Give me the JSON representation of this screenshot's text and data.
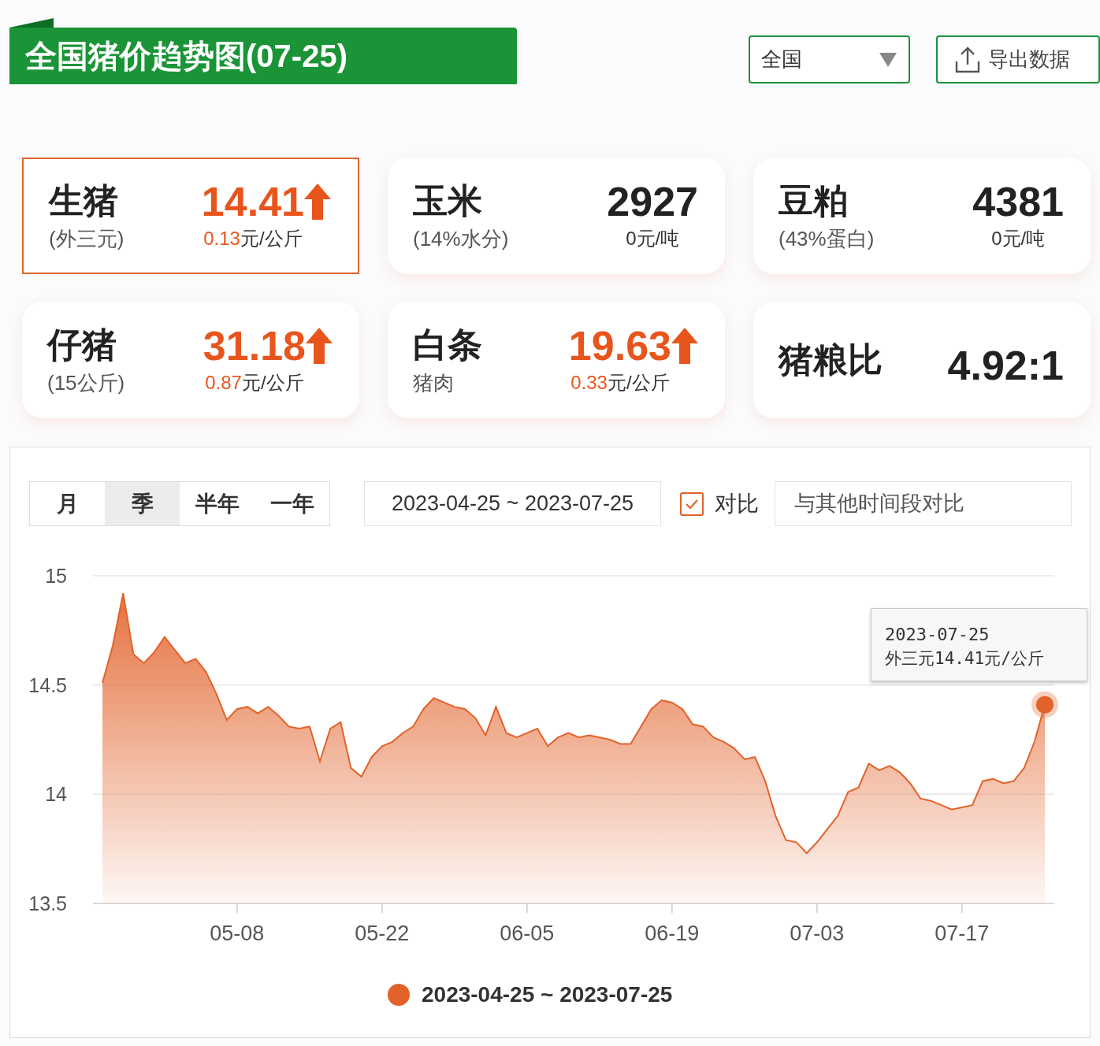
{
  "header": {
    "title": "全国猪价趋势图(07-25)",
    "region_select": {
      "value": "全国"
    },
    "export_button": "导出数据"
  },
  "cards": [
    {
      "kind": "price",
      "name": "生猪",
      "sub": "(外三元)",
      "value": "14.41",
      "rising": true,
      "change": "0.13",
      "unit": "元/公斤",
      "selected": true
    },
    {
      "kind": "price",
      "name": "玉米",
      "sub": "(14%水分)",
      "value": "2927",
      "rising": false,
      "change": "0",
      "unit": "元/吨",
      "selected": false
    },
    {
      "kind": "price",
      "name": "豆粕",
      "sub": "(43%蛋白)",
      "value": "4381",
      "rising": false,
      "change": "0",
      "unit": "元/吨",
      "selected": false
    },
    {
      "kind": "price",
      "name": "仔猪",
      "sub": "(15公斤)",
      "value": "31.18",
      "rising": true,
      "change": "0.87",
      "unit": "元/公斤",
      "selected": false
    },
    {
      "kind": "price",
      "name": "白条",
      "sub": "猪肉",
      "value": "19.63",
      "rising": true,
      "change": "0.33",
      "unit": "元/公斤",
      "selected": false
    },
    {
      "kind": "ratio",
      "name": "猪粮比",
      "value": "4.92:1",
      "selected": false
    }
  ],
  "controls": {
    "periods": [
      {
        "label": "月",
        "selected": false
      },
      {
        "label": "季",
        "selected": true
      },
      {
        "label": "半年",
        "selected": false
      },
      {
        "label": "一年",
        "selected": false
      }
    ],
    "date_range": "2023-04-25 ~ 2023-07-25",
    "compare": {
      "label": "对比",
      "checked": true
    },
    "compare_field": {
      "placeholder": "与其他时间段对比"
    }
  },
  "chart": {
    "tooltip": {
      "date": "2023-07-25",
      "text": "外三元14.41元/公斤"
    },
    "chart_data": {
      "type": "area",
      "categories": [
        null,
        null,
        null,
        null,
        null,
        null,
        null,
        null,
        null,
        null,
        null,
        null,
        null,
        "05-08",
        null,
        null,
        null,
        null,
        null,
        null,
        null,
        null,
        null,
        null,
        null,
        null,
        null,
        "05-22",
        null,
        null,
        null,
        null,
        null,
        null,
        null,
        null,
        null,
        null,
        null,
        null,
        null,
        "06-05",
        null,
        null,
        null,
        null,
        null,
        null,
        null,
        null,
        null,
        null,
        null,
        null,
        null,
        "06-19",
        null,
        null,
        null,
        null,
        null,
        null,
        null,
        null,
        null,
        null,
        null,
        null,
        null,
        "07-03",
        null,
        null,
        null,
        null,
        null,
        null,
        null,
        null,
        null,
        null,
        null,
        null,
        null,
        "07-17",
        null,
        null,
        null,
        null,
        null,
        null,
        null,
        null
      ],
      "series": [
        {
          "name": "2023-04-25 ~ 2023-07-25",
          "color": "#e2622a",
          "values": [
            14.51,
            14.68,
            14.92,
            14.64,
            14.6,
            14.65,
            14.72,
            14.66,
            14.6,
            14.62,
            14.56,
            14.46,
            14.34,
            14.39,
            14.4,
            14.37,
            14.4,
            14.36,
            14.31,
            14.3,
            14.31,
            14.15,
            14.3,
            14.33,
            14.12,
            14.08,
            14.17,
            14.22,
            14.24,
            14.28,
            14.31,
            14.39,
            14.44,
            14.42,
            14.4,
            14.39,
            14.35,
            14.27,
            14.4,
            14.28,
            14.26,
            14.28,
            14.3,
            14.22,
            14.26,
            14.28,
            14.26,
            14.27,
            14.26,
            14.25,
            14.23,
            14.23,
            14.31,
            14.39,
            14.43,
            14.42,
            14.39,
            14.32,
            14.31,
            14.26,
            14.24,
            14.21,
            14.16,
            14.17,
            14.06,
            13.9,
            13.79,
            13.78,
            13.73,
            13.78,
            13.84,
            13.9,
            14.01,
            14.03,
            14.14,
            14.11,
            14.13,
            14.1,
            14.05,
            13.98,
            13.97,
            13.95,
            13.93,
            13.94,
            13.95,
            14.06,
            14.07,
            14.05,
            14.06,
            14.12,
            14.24,
            14.41
          ]
        }
      ],
      "ylim": [
        13.5,
        15
      ],
      "yticks": [
        13.5,
        14,
        14.5,
        15
      ]
    }
  }
}
